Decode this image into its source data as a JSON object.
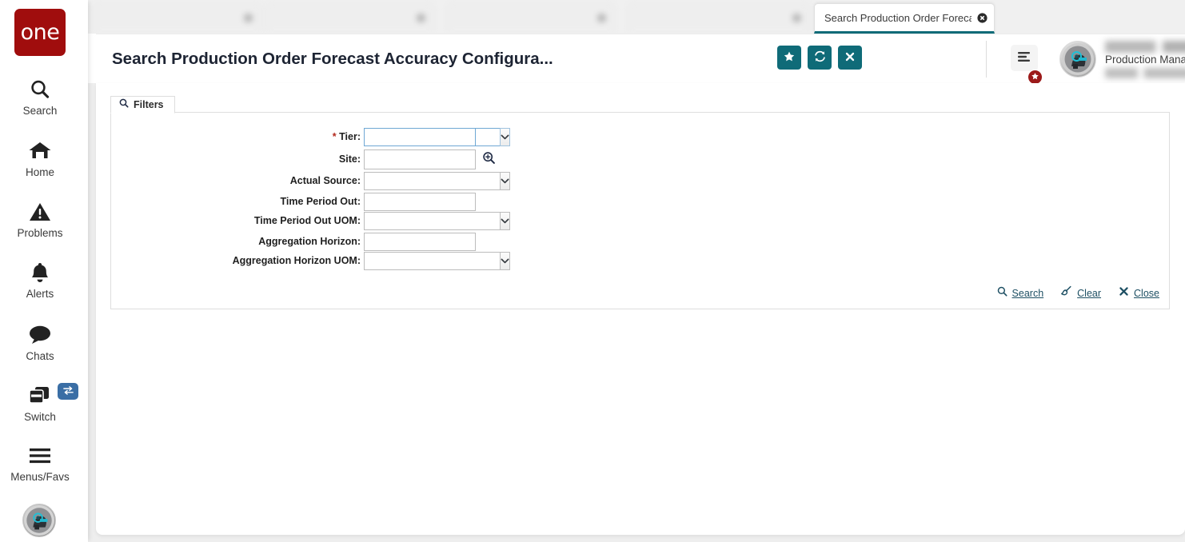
{
  "app": {
    "logo_text": "one",
    "brand_color": "#a00d0d",
    "accent_color": "#0f6b78",
    "badge_color": "#9c1a1a",
    "switch_badge_color": "#3a6ea5"
  },
  "sidebar": {
    "items": [
      {
        "label": "Search",
        "icon": "search-icon"
      },
      {
        "label": "Home",
        "icon": "home-icon"
      },
      {
        "label": "Problems",
        "icon": "warning-triangle-icon"
      },
      {
        "label": "Alerts",
        "icon": "bell-icon"
      },
      {
        "label": "Chats",
        "icon": "chat-bubble-icon"
      },
      {
        "label": "Switch",
        "icon": "windows-stack-icon"
      },
      {
        "label": "Menus/Favs",
        "icon": "hamburger-icon"
      }
    ],
    "switch_badge_icon": "swap-arrows-icon",
    "avatar_icon": "user-avatar-icon"
  },
  "tabs": [
    {
      "title": "",
      "active": false,
      "blurred": true
    },
    {
      "title": "",
      "active": false,
      "blurred": true
    },
    {
      "title": "",
      "active": false,
      "blurred": true
    },
    {
      "title": "",
      "active": false,
      "blurred": true
    },
    {
      "title": "Search Production Order Foreca...",
      "active": true,
      "blurred": false
    }
  ],
  "header": {
    "title": "Search Production Order Forecast Accuracy Configura...",
    "actions": [
      {
        "name": "favorite-button",
        "icon": "star-icon",
        "label": "Favorite"
      },
      {
        "name": "refresh-button",
        "icon": "refresh-icon",
        "label": "Refresh"
      },
      {
        "name": "close-button",
        "icon": "close-icon",
        "label": "Close"
      }
    ],
    "menu_favs": {
      "icon": "hamburger-icon",
      "badge_icon": "star-icon"
    },
    "user": {
      "name": "",
      "role": "Production Manager",
      "organization": "",
      "caret_icon": "chevron-down-icon"
    }
  },
  "filters": {
    "tab_label": "Filters",
    "tab_icon": "search-icon",
    "fields": [
      {
        "label": "Tier:",
        "required": true,
        "type": "select",
        "value": "",
        "focused": true
      },
      {
        "label": "Site:",
        "required": false,
        "type": "lookup",
        "value": "",
        "lookup_icon": "magnifier-plus-icon"
      },
      {
        "label": "Actual Source:",
        "required": false,
        "type": "select",
        "value": ""
      },
      {
        "label": "Time Period Out:",
        "required": false,
        "type": "text",
        "value": ""
      },
      {
        "label": "Time Period Out UOM:",
        "required": false,
        "type": "select",
        "value": ""
      },
      {
        "label": "Aggregation Horizon:",
        "required": false,
        "type": "text",
        "value": ""
      },
      {
        "label": "Aggregation Horizon UOM:",
        "required": false,
        "type": "select",
        "value": ""
      }
    ],
    "actions": [
      {
        "label": "Search",
        "icon": "search-icon"
      },
      {
        "label": "Clear",
        "icon": "broom-icon"
      },
      {
        "label": "Close",
        "icon": "close-x-icon"
      }
    ]
  }
}
